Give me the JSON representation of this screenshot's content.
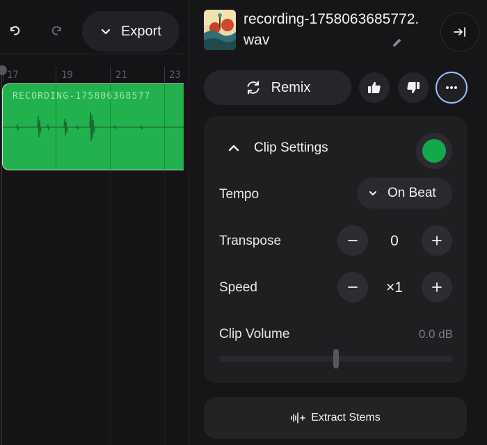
{
  "toolbar": {
    "undo_icon": "undo-icon",
    "redo_icon": "redo-icon",
    "export_label": "Export"
  },
  "timeline": {
    "ruler_numbers": [
      "17",
      "19",
      "21",
      "23"
    ],
    "clip": {
      "title": "RECORDING-175806368577",
      "color": "#22b14c"
    }
  },
  "panel": {
    "file_name": "recording-1758063685772.wav",
    "remix_label": "Remix",
    "settings": {
      "title": "Clip Settings",
      "clip_color": "#13a84a",
      "tempo_label": "Tempo",
      "tempo_value": "On Beat",
      "transpose_label": "Transpose",
      "transpose_value": "0",
      "speed_label": "Speed",
      "speed_value": "×1",
      "volume_label": "Clip Volume",
      "volume_value": "0.0 dB",
      "volume_slider_fraction": 0.5
    },
    "extract_label": "Extract Stems"
  },
  "colors": {
    "accent_focus": "#9ec1ff",
    "clip_green": "#22b14c"
  }
}
